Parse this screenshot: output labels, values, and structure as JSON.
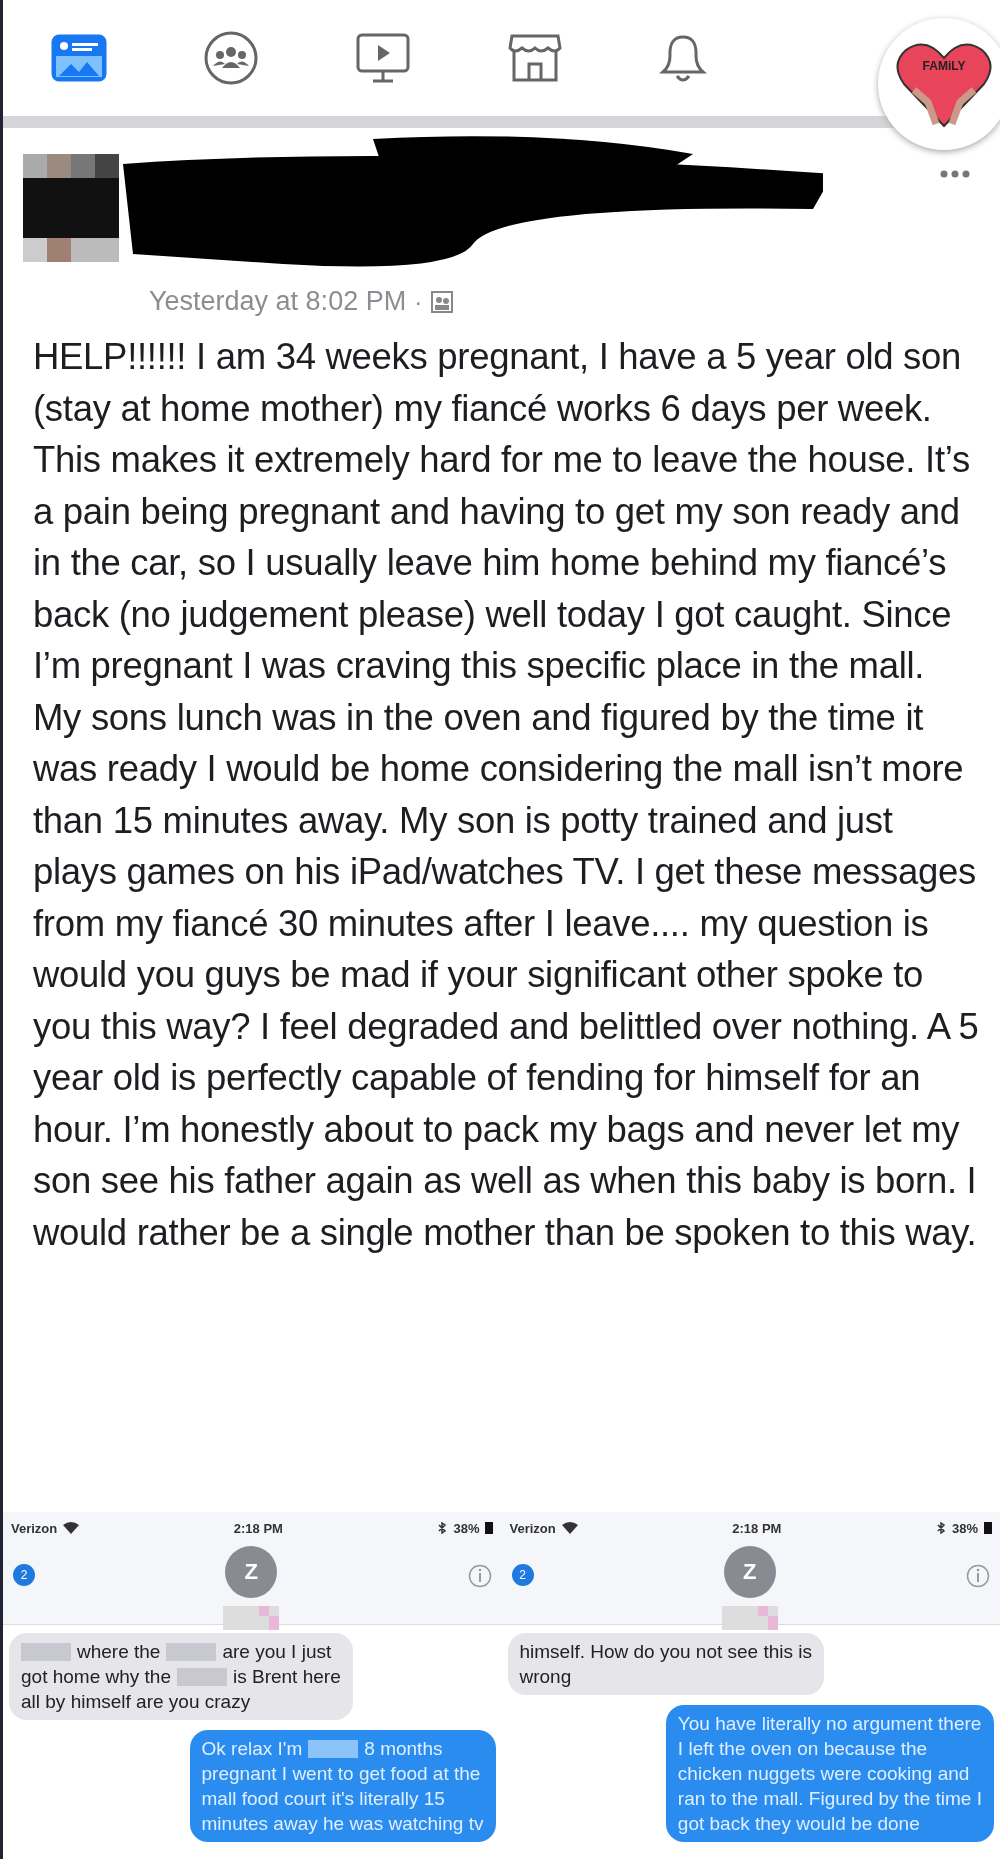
{
  "nav": {
    "items": [
      {
        "kind": "feed",
        "selected": true
      },
      {
        "kind": "groups",
        "selected": false
      },
      {
        "kind": "video",
        "selected": false
      },
      {
        "kind": "marketplace",
        "selected": false
      },
      {
        "kind": "notifications",
        "selected": false
      }
    ],
    "profile_badge": "FAMiLY"
  },
  "post": {
    "timestamp": "Yesterday at 8:02 PM",
    "separator": "·",
    "body": "HELP!!!!!! I am 34 weeks pregnant, I have a 5 year old son (stay at home mother) my fiancé works 6 days per week. This makes it extremely hard for me to leave the house. It’s a pain being pregnant and having to get my son ready and in the car, so I usually leave him home behind my fiancé’s back (no judgement please) well today I got caught. Since I’m pregnant I was craving this specific place in the mall. My sons lunch was in the oven and figured by the time it was ready I would be home considering the mall isn’t more than 15 minutes away. My son is potty trained and just plays games on his iPad/watches TV. I get these messages from my fiancé 30 minutes after I leave.... my question is would you guys be mad if your significant other spoke to you this way? I feel degraded and belittled over nothing. A 5 year old is perfectly capable of fending for himself for an hour. I’m honestly about to pack my bags and never let my son see his father again as well as when this baby is born. I would rather be a single mother than be spoken to this way."
  },
  "screenshots": [
    {
      "carrier": "Verizon",
      "time": "2:18 PM",
      "battery": "38%",
      "back_badge": "2",
      "avatar": "Z",
      "messages": [
        {
          "kind": "received",
          "lines": [
            [
              {
                "kind": "redacted"
              },
              {
                "kind": "text",
                "text": "where the"
              },
              {
                "kind": "redacted"
              },
              {
                "kind": "text",
                "text": "are you I just"
              }
            ],
            [
              {
                "kind": "text",
                "text": "got home why the"
              },
              {
                "kind": "redacted"
              },
              {
                "kind": "text",
                "text": "is Brent here"
              }
            ],
            [
              {
                "kind": "text",
                "text": "all by himself are you crazy"
              }
            ]
          ]
        },
        {
          "kind": "sent",
          "lines": [
            [
              {
                "kind": "text",
                "text": "Ok relax I'm"
              },
              {
                "kind": "redacted"
              },
              {
                "kind": "text",
                "text": "8 months"
              }
            ],
            [
              {
                "kind": "text",
                "text": "pregnant I went to get food at the"
              }
            ],
            [
              {
                "kind": "text",
                "text": "mall food court it's literally 15"
              }
            ],
            [
              {
                "kind": "text",
                "text": "minutes away he was watching tv"
              }
            ]
          ]
        }
      ]
    },
    {
      "carrier": "Verizon",
      "time": "2:18 PM",
      "battery": "38%",
      "back_badge": "2",
      "avatar": "Z",
      "messages": [
        {
          "kind": "received",
          "lines": [
            [
              {
                "kind": "text",
                "text": "himself. How do you not see this is"
              }
            ],
            [
              {
                "kind": "text",
                "text": "wrong"
              }
            ]
          ]
        },
        {
          "kind": "sent",
          "lines": [
            [
              {
                "kind": "text",
                "text": "You have literally no argument there"
              }
            ],
            [
              {
                "kind": "text",
                "text": "I left the oven on because the"
              }
            ],
            [
              {
                "kind": "text",
                "text": "chicken nuggets were cooking and"
              }
            ],
            [
              {
                "kind": "text",
                "text": "ran to the mall. Figured by the time I"
              }
            ],
            [
              {
                "kind": "text",
                "text": "got back they would be done"
              }
            ]
          ]
        }
      ]
    }
  ]
}
